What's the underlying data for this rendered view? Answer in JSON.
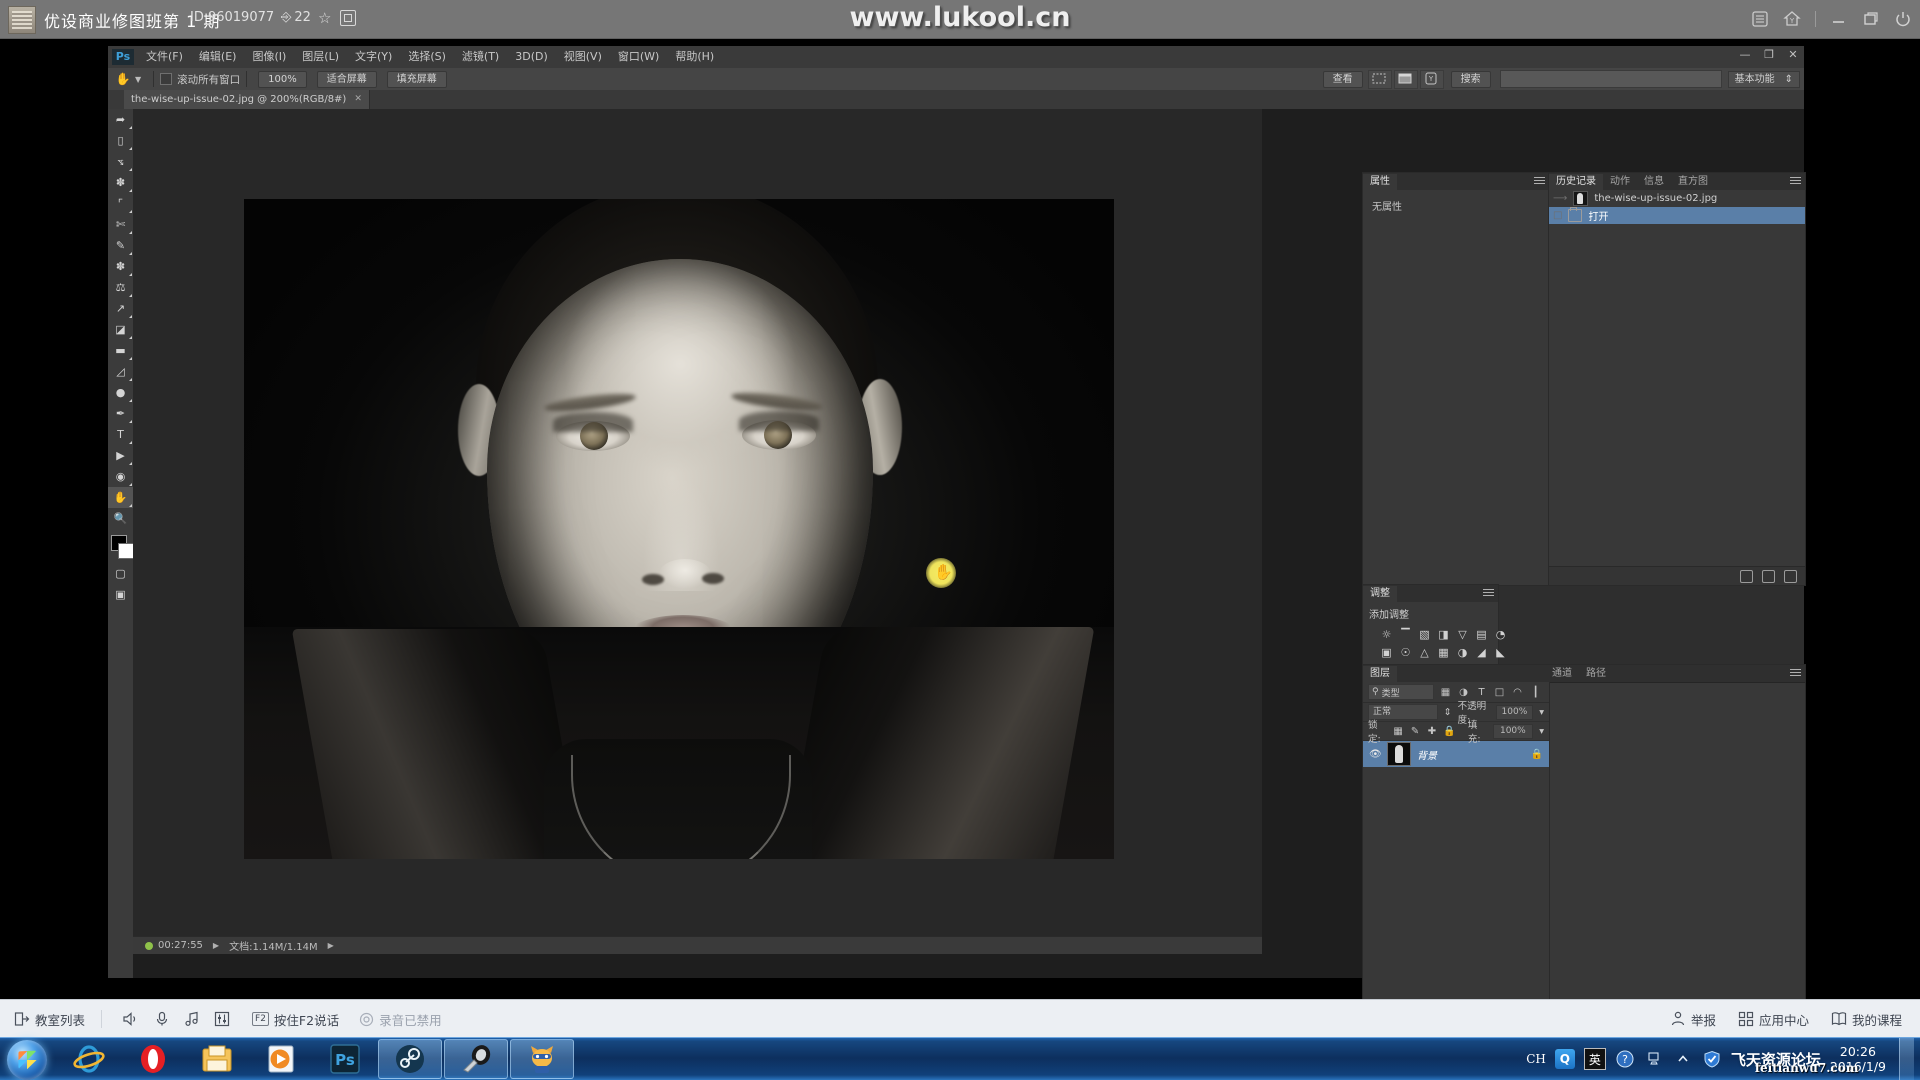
{
  "topbar": {
    "course_title": "优设商业修图班第 1 期",
    "id_label": "ID 96019077",
    "viewers": "22",
    "viewers_icon": "people-icon",
    "star_icon": "star-icon",
    "fullscreen_icon": "fullscreen-icon",
    "watermark": "www.lukool.cn",
    "right_icons": [
      "list-icon",
      "home-icon",
      "minimize-icon",
      "restore-icon",
      "power-icon"
    ]
  },
  "photoshop": {
    "app_logo": "Ps",
    "menus": [
      "文件(F)",
      "编辑(E)",
      "图像(I)",
      "图层(L)",
      "文字(Y)",
      "选择(S)",
      "滤镜(T)",
      "3D(D)",
      "视图(V)",
      "窗口(W)",
      "帮助(H)"
    ],
    "window_controls": [
      "—",
      "❐",
      "✕"
    ],
    "options_bar": {
      "tool_icon": "hand-tool-icon",
      "scroll_all_windows_label": "滚动所有窗口",
      "scroll_all_windows_checked": false,
      "zoom_100_label": "100%",
      "fit_screen_label": "适合屏幕",
      "fill_screen_label": "填充屏幕",
      "view_label": "查看",
      "search_label": "搜索",
      "workspace_label": "基本功能"
    },
    "document_tab": {
      "title": "the-wise-up-issue-02.jpg @ 200%(RGB/8#)",
      "close_glyph": "✕"
    },
    "toolbar_tools": [
      "move-tool",
      "marquee-tool",
      "lasso-tool",
      "quick-selection-tool",
      "crop-tool",
      "eyedropper-tool",
      "healing-brush-tool",
      "brush-tool",
      "clone-stamp-tool",
      "history-brush-tool",
      "eraser-tool",
      "gradient-tool",
      "blur-tool",
      "dodge-tool",
      "pen-tool",
      "type-tool",
      "path-selection-tool",
      "shape-tool",
      "hand-tool",
      "zoom-tool"
    ],
    "selected_tool": "hand-tool",
    "foreground_color": "#000000",
    "background_color": "#ffffff",
    "status_bar": {
      "timer": "00:27:55",
      "doc_size": "文档:1.14M/1.14M",
      "arrow_glyph": "▶"
    },
    "panels": {
      "properties": {
        "tabs": [
          "属性"
        ],
        "active_tab": "属性",
        "empty_text": "无属性"
      },
      "history": {
        "tabs": [
          "历史记录",
          "动作",
          "信息",
          "直方图"
        ],
        "active_tab": "历史记录",
        "snapshot": "the-wise-up-issue-02.jpg",
        "items": [
          {
            "label": "打开",
            "selected": true
          }
        ]
      },
      "adjustments": {
        "tabs": [
          "调整"
        ],
        "active_tab": "调整",
        "title": "添加调整",
        "icons": [
          "brightness-contrast-icon",
          "levels-icon",
          "curves-icon",
          "exposure-icon",
          "vibrance-icon",
          "hue-saturation-icon",
          "color-balance-icon",
          "black-white-icon",
          "photo-filter-icon",
          "channel-mixer-icon",
          "color-lookup-icon",
          "invert-icon",
          "posterize-icon",
          "threshold-icon",
          "selective-color-icon",
          "gradient-map-icon"
        ]
      },
      "layers": {
        "tabs": [
          "图层",
          "通道",
          "路径"
        ],
        "active_tab": "图层",
        "filter_kind_label": "类型",
        "filter_icons": [
          "pixel-filter-icon",
          "adjustment-filter-icon",
          "type-filter-icon",
          "shape-filter-icon",
          "smart-object-filter-icon",
          "filter-toggle-icon"
        ],
        "blend_mode": "正常",
        "opacity_label": "不透明度:",
        "opacity_value": "100%",
        "lock_label": "锁定:",
        "lock_icons": [
          "lock-transparent-icon",
          "lock-image-icon",
          "lock-position-icon",
          "lock-all-icon"
        ],
        "fill_label": "填充:",
        "fill_value": "100%",
        "items": [
          {
            "name": "背景",
            "visible": true,
            "locked": true,
            "selected": true
          }
        ]
      }
    }
  },
  "classroom_bar": {
    "room_list_label": "教室列表",
    "speaker_icon": "speaker-icon",
    "mic_icon": "microphone-icon",
    "music_icon": "music-icon",
    "mixer_icon": "equalizer-icon",
    "push_to_talk_key": "F2",
    "push_to_talk_label": "按住F2说话",
    "record_status_icon": "record-icon",
    "record_status_label": "录音已禁用",
    "report_label": "举报",
    "app_center_label": "应用中心",
    "my_courses_label": "我的课程"
  },
  "taskbar": {
    "start_icon": "windows-start-icon",
    "items": [
      {
        "name": "internet-explorer",
        "open": false
      },
      {
        "name": "opera-browser",
        "open": false
      },
      {
        "name": "windows-explorer",
        "open": false
      },
      {
        "name": "media-player",
        "open": false
      },
      {
        "name": "photoshop",
        "open": false
      },
      {
        "name": "steam",
        "open": true
      },
      {
        "name": "horn-broadcast-app",
        "open": true
      },
      {
        "name": "cat-mascot-app",
        "open": true
      }
    ],
    "tray": {
      "ime_label": "CH",
      "qq_label": "Q",
      "ime_mode_label": "英",
      "help_icon": "help-icon",
      "network_icon": "network-icon",
      "show_hidden_icon": "chevron-up-icon",
      "security_icon": "security-shield-icon",
      "time": "20:26",
      "date": "2016/1/9",
      "watermark_main": "飞天资源论坛",
      "watermark_sub": "feitianwu7.com"
    }
  },
  "colors": {
    "top_bar_bg": "#767676",
    "ps_panel_bg": "#383838",
    "ps_canvas_bg": "#1e1e1e",
    "selection_blue": "#5a7fa8",
    "classbar_bg": "#eceff3",
    "taskbar_blue": "#0d2f5e"
  }
}
